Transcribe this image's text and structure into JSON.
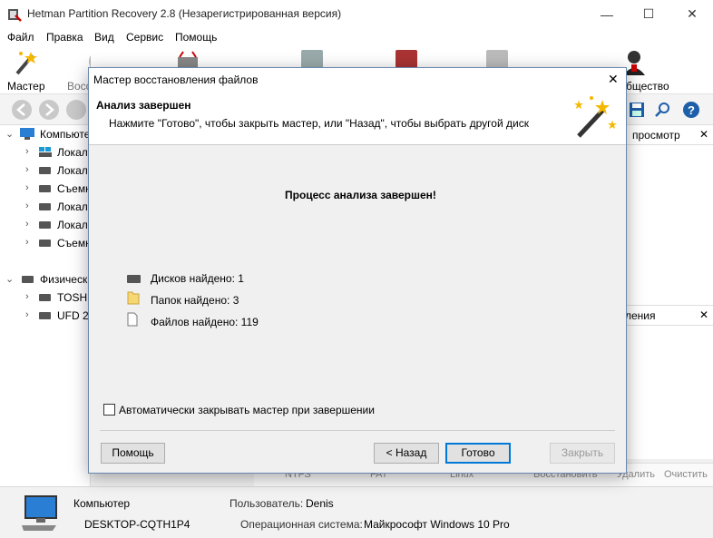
{
  "window": {
    "title": "Hetman Partition Recovery 2.8 (Незарегистрированная версия)",
    "minimize": "—",
    "maximize": "☐",
    "close": "✕"
  },
  "menu": [
    "Файл",
    "Правка",
    "Вид",
    "Сервис",
    "Помощь"
  ],
  "toolbar": {
    "wizard": "Мастер",
    "restore_partial": "Восс",
    "community_partial": "бщество"
  },
  "tree": {
    "group_computer": "Компьюте",
    "items": [
      "Локал",
      "Локал",
      "Съемн",
      "Локал",
      "Локал",
      "Съемн"
    ],
    "group_physical": "Физическ",
    "physical": [
      "TOSHI",
      "UFD 2."
    ]
  },
  "right": {
    "preview_partial": "просмотр",
    "panel2_partial": "ления",
    "close_icon": "✕"
  },
  "bottom_strip": {
    "fs1": "NTFS",
    "fs2": "FAT",
    "fs3": "Linux",
    "restore": "Восстановить",
    "delete": "Удалить",
    "clear": "Очистить"
  },
  "status": {
    "computer_label": "Компьютер",
    "computer_name": "DESKTOP-CQTH1P4",
    "user_label": "Пользователь:",
    "user_value": "Denis",
    "os_label": "Операционная система:",
    "os_value": "Майкрософт Windows 10 Pro"
  },
  "dialog": {
    "title": "Мастер восстановления файлов",
    "close": "✕",
    "header_title": "Анализ завершен",
    "header_sub": "Нажмите \"Готово\", чтобы закрыть мастер, или \"Назад\", чтобы выбрать другой диск",
    "process_done": "Процесс анализа завершен!",
    "disks_found": "Дисков найдено: 1",
    "folders_found": "Папок найдено: 3",
    "files_found": "Файлов найдено: 119",
    "auto_close_label": "Автоматически закрывать мастер при завершении",
    "auto_close_checked": false,
    "help_btn": "Помощь",
    "back_btn": "< Назад",
    "finish_btn": "Готово",
    "close_btn": "Закрыть"
  }
}
